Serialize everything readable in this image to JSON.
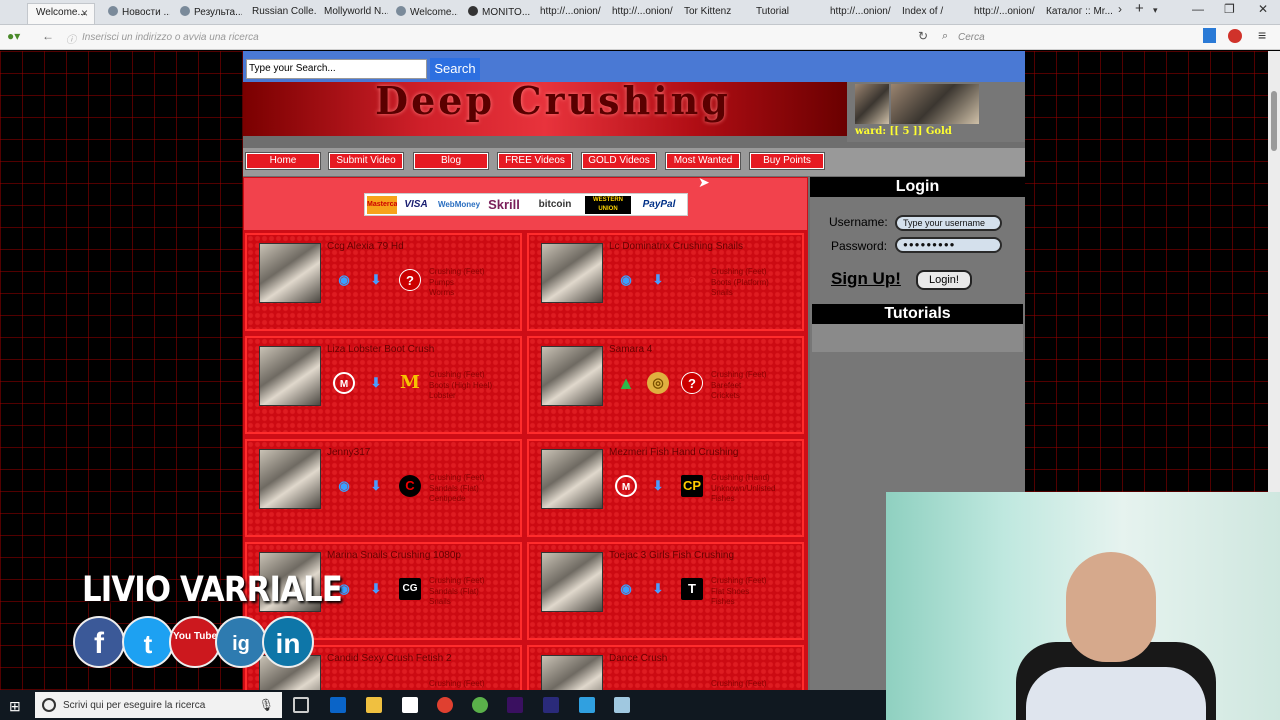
{
  "browser": {
    "tabs": [
      {
        "label": "Welcome...",
        "active": true
      },
      {
        "label": "Новости ..."
      },
      {
        "label": "Результа..."
      },
      {
        "label": "Russian Colle..."
      },
      {
        "label": "Mollyworld N..."
      },
      {
        "label": "Welcome..."
      },
      {
        "label": "MONITO..."
      },
      {
        "label": "http://...onion/"
      },
      {
        "label": "http://...onion/"
      },
      {
        "label": "Tor Kittenz"
      },
      {
        "label": "Tutorial"
      },
      {
        "label": "http://...onion/"
      },
      {
        "label": "Index of /"
      },
      {
        "label": "http://...onion/"
      },
      {
        "label": "Каталог :: Mr..."
      }
    ],
    "new_tab_symbol": "+",
    "url_placeholder": "Inserisci un indirizzo o avvia una ricerca",
    "search_placeholder": "Cerca"
  },
  "site": {
    "search": {
      "placeholder": "Type your Search...",
      "button": "Search"
    },
    "banner_title": "Deep Crushing",
    "award_text": "ward: [[ 5 ]] Gold",
    "menu": [
      "Home",
      "Submit Video",
      "Blog",
      "FREE Videos",
      "GOLD Videos",
      "Most Wanted",
      "Buy Points"
    ],
    "payment_logos": [
      "Mastercard",
      "VISA",
      "WebMoney",
      "Skrill",
      "bitcoin",
      "WESTERN UNION",
      "PayPal"
    ],
    "videos": [
      {
        "title": "Ccg Alexia 79 Hd",
        "tags": "Crushing (Feet)\nPumps\nWorms"
      },
      {
        "title": "Lc Dominatrix Crushing Snails",
        "tags": "Crushing (Feet)\nBoots (Platform)\nSnails"
      },
      {
        "title": "Liza Lobster Boot Crush",
        "tags": "Crushing (Feet)\nBoots (High Heel)\nLobster"
      },
      {
        "title": "Samara 4",
        "tags": "Crushing (Feet)\nBarefeet\nCrickets"
      },
      {
        "title": "Jenny317",
        "tags": "Crushing (Feet)\nSandals (Flat)\nCentipede"
      },
      {
        "title": "Mezmeri Fish Hand Crushing",
        "tags": "Crushing (Hand)\nUnknown/Unlisted\nFishes"
      },
      {
        "title": "Marina Snails Crushing 1080p",
        "tags": "Crushing (Feet)\nSandals (Flat)\nSnails"
      },
      {
        "title": "Toejac 3 Girls Fish Crushing",
        "tags": "Crushing (Feet)\nFlat Shoes\nFishes"
      },
      {
        "title": "Candid Sexy Crush Fetish 2",
        "tags": "Crushing (Feet)"
      },
      {
        "title": "Dance Crush",
        "tags": "Crushing (Feet)"
      }
    ],
    "login": {
      "title": "Login",
      "username_label": "Username:",
      "username_placeholder": "Type your username",
      "password_label": "Password:",
      "password_mask": "●●●●●●●●●",
      "signup": "Sign Up!",
      "login_button": "Login!"
    },
    "tutorials_title": "Tutorials"
  },
  "overlay": {
    "brand_name": "LIVIO VARRIALE",
    "social": [
      "f",
      "t",
      "You Tube",
      "ig",
      "in"
    ]
  },
  "taskbar": {
    "search_placeholder": "Scrivi qui per eseguire la ricerca"
  }
}
